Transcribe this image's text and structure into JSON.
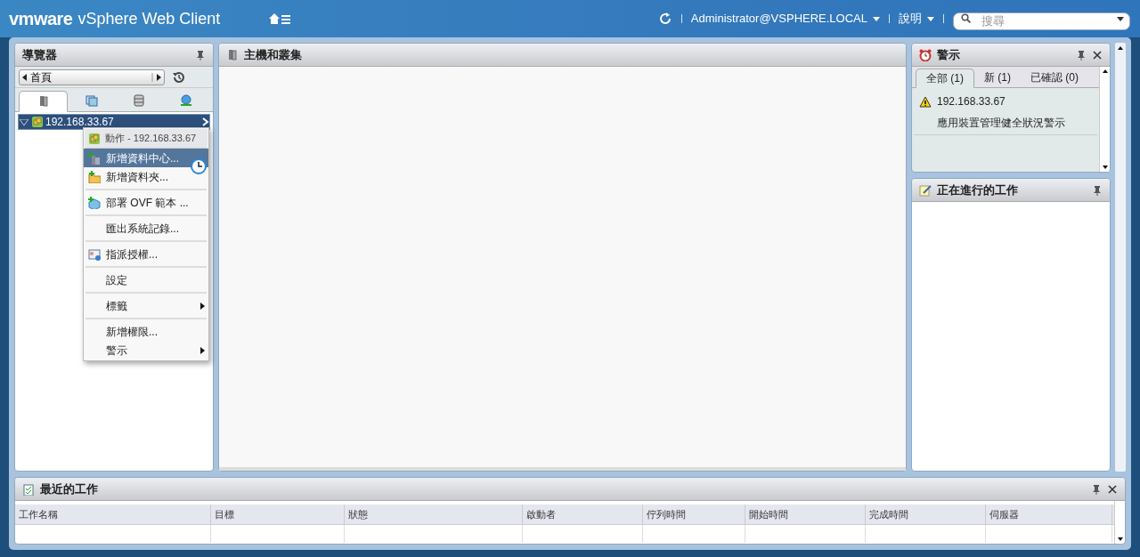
{
  "header": {
    "brand": "vmware",
    "product": "vSphere Web Client",
    "user": "Administrator@VSPHERE.LOCAL",
    "help": "說明",
    "search": {
      "placeholder": "搜尋"
    }
  },
  "navigator": {
    "title": "導覽器",
    "breadcrumb": "首頁",
    "icon_tabs": [
      {
        "selected": true
      },
      {
        "selected": false
      },
      {
        "selected": false
      },
      {
        "selected": false
      }
    ],
    "tree": [
      {
        "label": "192.168.33.67",
        "expanded": true,
        "selected": true
      }
    ]
  },
  "context_menu": {
    "title": "動作 - 192.168.33.67",
    "items": [
      {
        "kind": "item",
        "label": "新增資料中心...",
        "selected": true,
        "submenu": false
      },
      {
        "kind": "item",
        "label": "新增資料夾...",
        "selected": false,
        "submenu": false
      },
      {
        "kind": "separator"
      },
      {
        "kind": "item",
        "label": "部署 OVF 範本 ...",
        "selected": false,
        "submenu": false
      },
      {
        "kind": "separator"
      },
      {
        "kind": "item",
        "label": "匯出系統記錄...",
        "selected": false,
        "submenu": false
      },
      {
        "kind": "separator"
      },
      {
        "kind": "item",
        "label": "指派授權...",
        "selected": false,
        "submenu": false
      },
      {
        "kind": "separator"
      },
      {
        "kind": "item",
        "label": "設定",
        "selected": false,
        "submenu": false
      },
      {
        "kind": "separator"
      },
      {
        "kind": "item",
        "label": "標籤",
        "selected": false,
        "submenu": true
      },
      {
        "kind": "separator"
      },
      {
        "kind": "item",
        "label": "新增權限...",
        "selected": false,
        "submenu": false
      },
      {
        "kind": "item",
        "label": "警示",
        "selected": false,
        "submenu": true
      }
    ]
  },
  "main": {
    "title": "主機和叢集"
  },
  "alarms": {
    "title": "警示",
    "tabs": [
      {
        "label": "全部 (1)",
        "selected": true
      },
      {
        "label": "新 (1)",
        "selected": false
      },
      {
        "label": "已確認 (0)",
        "selected": false
      }
    ],
    "items": [
      {
        "source": "192.168.33.67",
        "message": "應用裝置管理健全狀況警示"
      }
    ]
  },
  "work_in_progress": {
    "title": "正在進行的工作"
  },
  "recent_tasks": {
    "title": "最近的工作",
    "columns": [
      "工作名稱",
      "目標",
      "狀態",
      "啟動者",
      "佇列時間",
      "開始時間",
      "完成時間",
      "伺服器"
    ]
  }
}
